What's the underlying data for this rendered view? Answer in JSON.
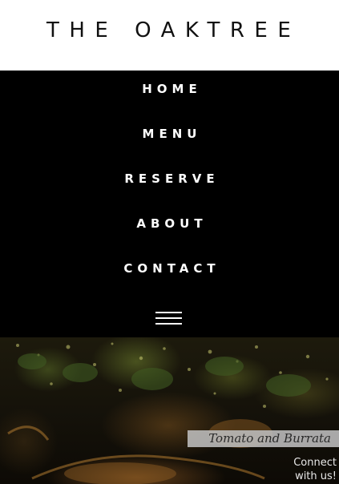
{
  "header": {
    "logo": "THE OAKTREE"
  },
  "nav": {
    "items": [
      {
        "label": "HOME"
      },
      {
        "label": "MENU"
      },
      {
        "label": "RESERVE"
      },
      {
        "label": "ABOUT"
      },
      {
        "label": "CONTACT"
      }
    ],
    "menu_icon": "hamburger-menu-icon"
  },
  "hero": {
    "caption": "Tomato and Burrata"
  },
  "connect": {
    "line1": "Connect",
    "line2": "with us!"
  },
  "colors": {
    "header_bg": "#ffffff",
    "nav_bg": "#000000",
    "nav_text": "#ffffff",
    "logo_text": "#111111",
    "caption_bg": "#bebebe"
  }
}
